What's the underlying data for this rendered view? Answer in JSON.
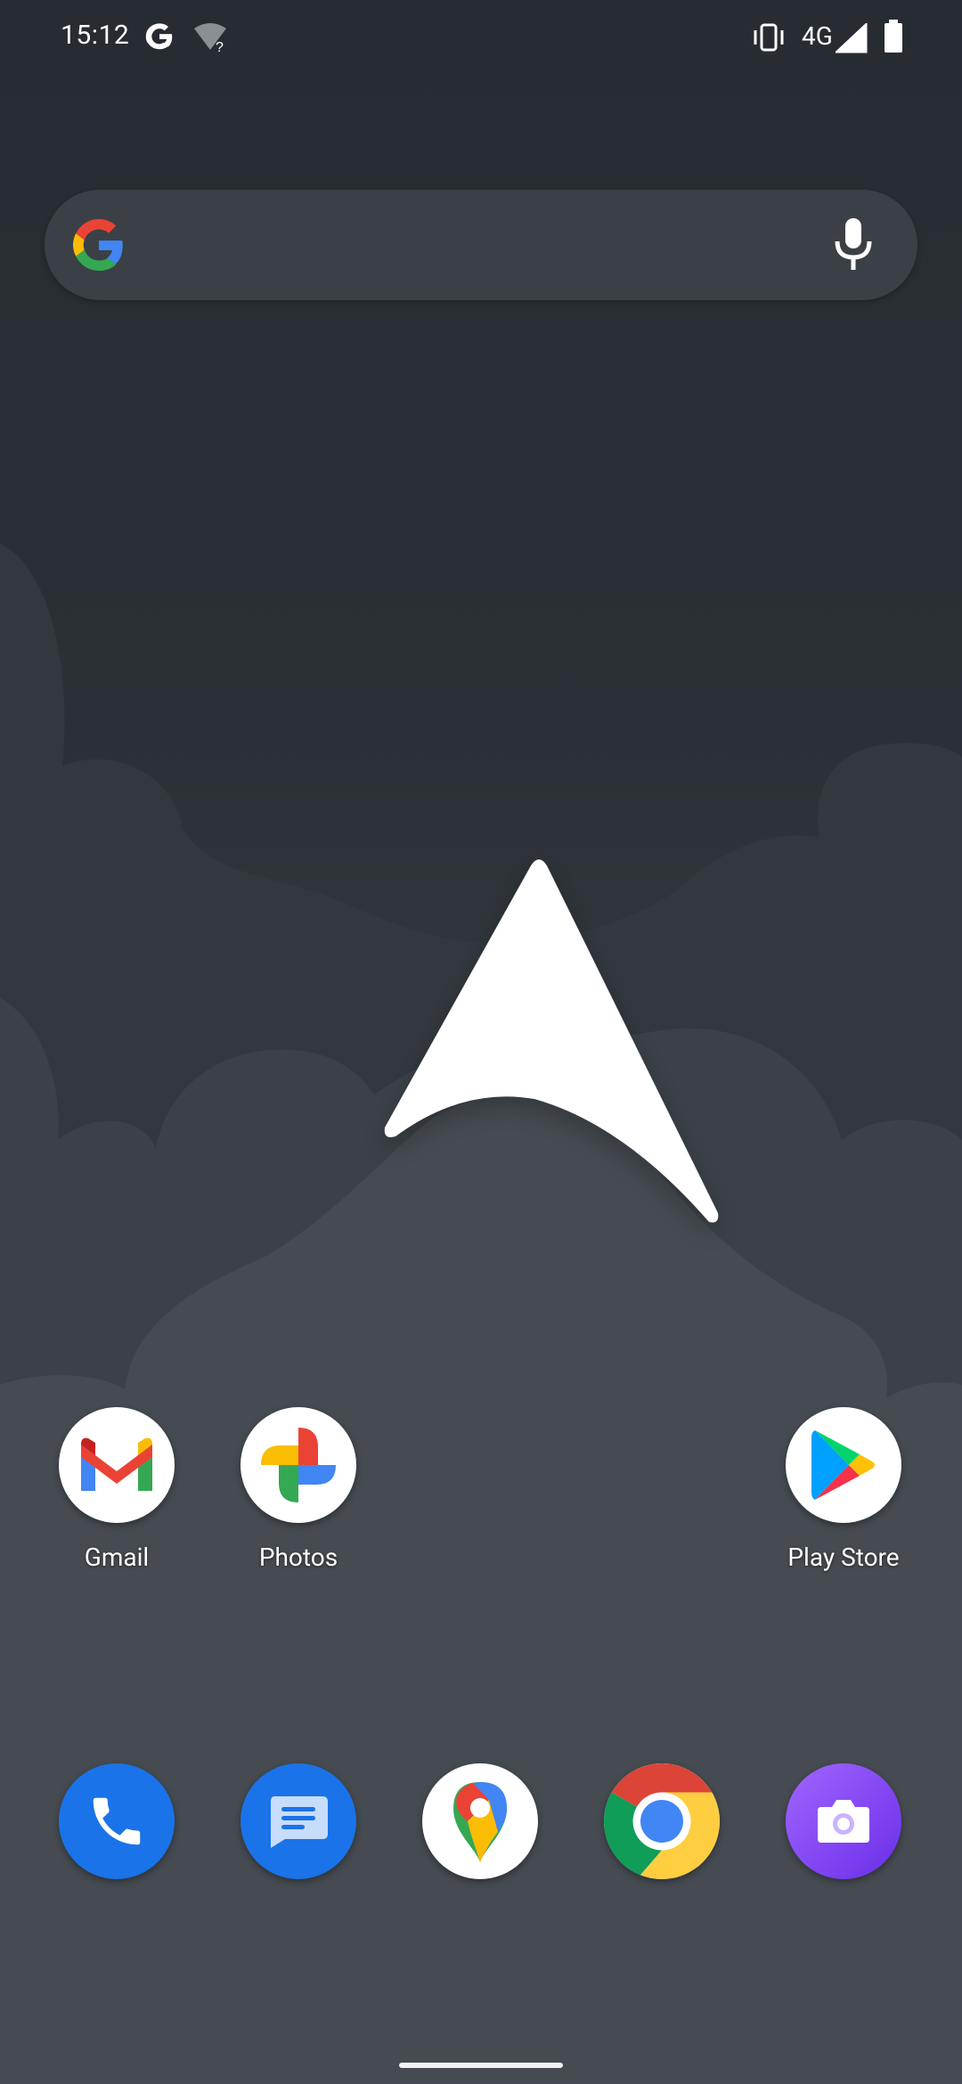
{
  "status_bar": {
    "time": "15:12",
    "network_type": "4G",
    "icons": [
      "google-icon",
      "wifi-unknown-icon",
      "vibrate-icon",
      "signal-icon",
      "battery-icon"
    ]
  },
  "search": {
    "icons": [
      "google-logo-icon",
      "microphone-icon"
    ]
  },
  "home_apps": [
    {
      "label": "Gmail",
      "icon": "gmail-icon"
    },
    {
      "label": "Photos",
      "icon": "photos-icon"
    },
    {
      "label": "Play Store",
      "icon": "play-store-icon"
    }
  ],
  "dock": [
    {
      "icon": "phone-icon",
      "color": "#1a73e8"
    },
    {
      "icon": "messages-icon",
      "color": "#1a73e8"
    },
    {
      "icon": "maps-icon",
      "color": "#ffffff"
    },
    {
      "icon": "chrome-icon",
      "color": "#ffffff"
    },
    {
      "icon": "camera-icon",
      "color": "#7b3ff2"
    }
  ],
  "colors": {
    "background_top": "#272d33",
    "background_bottom": "#4a5056",
    "search_bar": "#3b4046",
    "google_blue": "#4285f4",
    "google_red": "#ea4335",
    "google_yellow": "#fbbc04",
    "google_green": "#34a853"
  }
}
